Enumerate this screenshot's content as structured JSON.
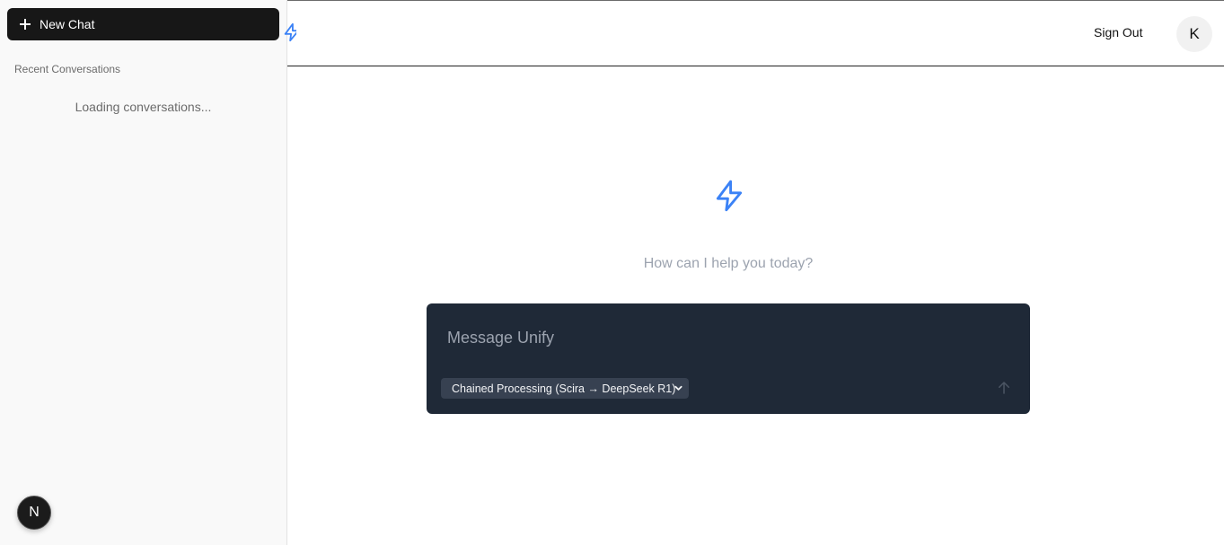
{
  "sidebar": {
    "new_chat_label": "New Chat",
    "recent_title": "Recent Conversations",
    "loading_text": "Loading conversations...",
    "badge_letter": "N"
  },
  "header": {
    "sign_out_label": "Sign Out",
    "avatar_initial": "K"
  },
  "main": {
    "prompt": "How can I help you today?",
    "message_placeholder": "Message Unify",
    "model_selected": "Chained Processing (Scira → DeepSeek R1)"
  },
  "colors": {
    "accent": "#3b82f6",
    "composer_bg": "#1f2937",
    "new_chat_bg": "#171717"
  },
  "icons": {
    "logo": "bolt-icon",
    "new_chat": "plus-icon",
    "send": "arrow-up-icon",
    "select": "chevron-down-icon"
  }
}
